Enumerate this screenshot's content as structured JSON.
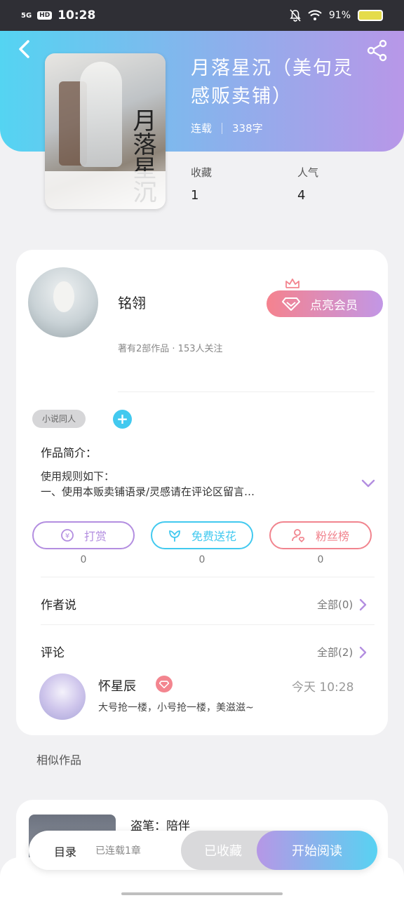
{
  "status_bar": {
    "signal": "5G",
    "hd": "HD",
    "time": "10:28",
    "battery": "91%"
  },
  "book": {
    "title": "月落星沉（美句灵感贩卖铺）",
    "status": "连载",
    "word_count": "338字",
    "cover_title": "月落星沉",
    "favorites_label": "收藏",
    "favorites_value": "1",
    "popularity_label": "人气",
    "popularity_value": "4"
  },
  "author": {
    "name": "铭翎",
    "info": "著有2部作品 · 153人关注",
    "vip_button": "点亮会员"
  },
  "tags": [
    "小说同人"
  ],
  "intro": {
    "label": "作品简介：",
    "line1": "使用规则如下：",
    "line2": "一、使用本贩卖铺语录/灵感请在评论区留言…"
  },
  "actions": [
    {
      "label": "打赏",
      "count": "0",
      "color": "#b38ee0"
    },
    {
      "label": "免费送花",
      "count": "0",
      "color": "#42c9ef"
    },
    {
      "label": "粉丝榜",
      "count": "0",
      "color": "#f1848e"
    }
  ],
  "author_says": {
    "label": "作者说",
    "more": "全部(0)"
  },
  "comments": {
    "label": "评论",
    "more": "全部(2)",
    "items": [
      {
        "name": "怀星辰",
        "time": "今天 10:28",
        "text": "大号抢一楼，小号抢一楼，美滋滋~"
      }
    ]
  },
  "similar": {
    "label": "相似作品",
    "items": [
      {
        "title": "盗笔：陪伴"
      }
    ]
  },
  "bottom_bar": {
    "toc_label": "目录",
    "toc_status": "已连载1章",
    "favorite_button": "已收藏",
    "read_button": "开始阅读"
  }
}
